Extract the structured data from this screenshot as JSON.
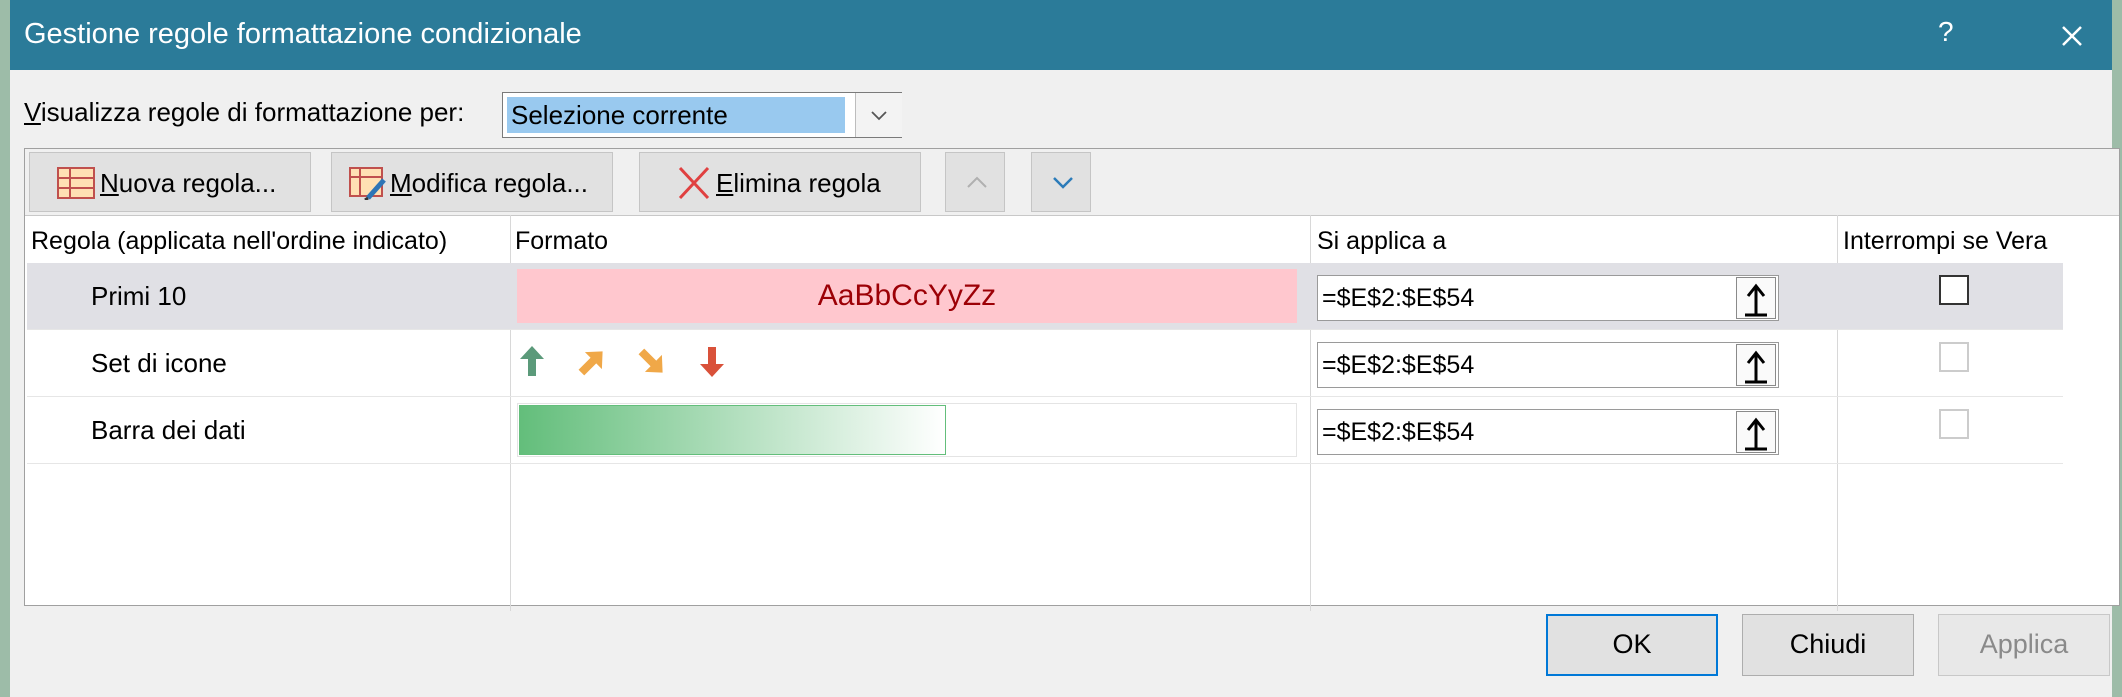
{
  "window": {
    "title": "Gestione regole formattazione condizionale",
    "help_label": "?"
  },
  "filter": {
    "label_first": "V",
    "label_rest": "isualizza regole di formattazione per:",
    "selected": "Selezione corrente"
  },
  "toolbar": {
    "new_rule_u": "N",
    "new_rule_rest": "uova regola...",
    "edit_rule_u": "M",
    "edit_rule_rest": "odifica regola...",
    "delete_rule_u": "E",
    "delete_rule_rest": "limina regola"
  },
  "table": {
    "headers": {
      "rule": "Regola (applicata nell'ordine indicato)",
      "format": "Formato",
      "applies_to": "Si applica a",
      "stop_if_true": "Interrompi se Vera"
    },
    "rows": [
      {
        "name": "Primi 10",
        "format_preview": "AaBbCcYyZz",
        "applies_to": "=$E$2:$E$54",
        "stop_if_true": false,
        "selected": true
      },
      {
        "name": "Set di icone",
        "format_preview": "",
        "applies_to": "=$E$2:$E$54",
        "stop_if_true": false,
        "icons": [
          "arrow-up-icon",
          "arrow-up-right-icon",
          "arrow-down-right-icon",
          "arrow-down-icon"
        ]
      },
      {
        "name": "Barra dei dati",
        "format_preview": "",
        "applies_to": "=$E$2:$E$54",
        "stop_if_true": false,
        "data_bar_fraction": 0.55
      }
    ]
  },
  "buttons": {
    "ok": "OK",
    "close": "Chiudi",
    "apply": "Applica"
  },
  "colors": {
    "titlebar": "#2b7b99",
    "selection": "#99c9ef",
    "highlight_fill": "#ffc7ce",
    "highlight_text": "#9c0006",
    "data_bar": "#63be7b",
    "icon_green": "#5b9a7a",
    "icon_orange": "#f0a848",
    "icon_red": "#d9513a",
    "default_button_border": "#0078d7"
  }
}
